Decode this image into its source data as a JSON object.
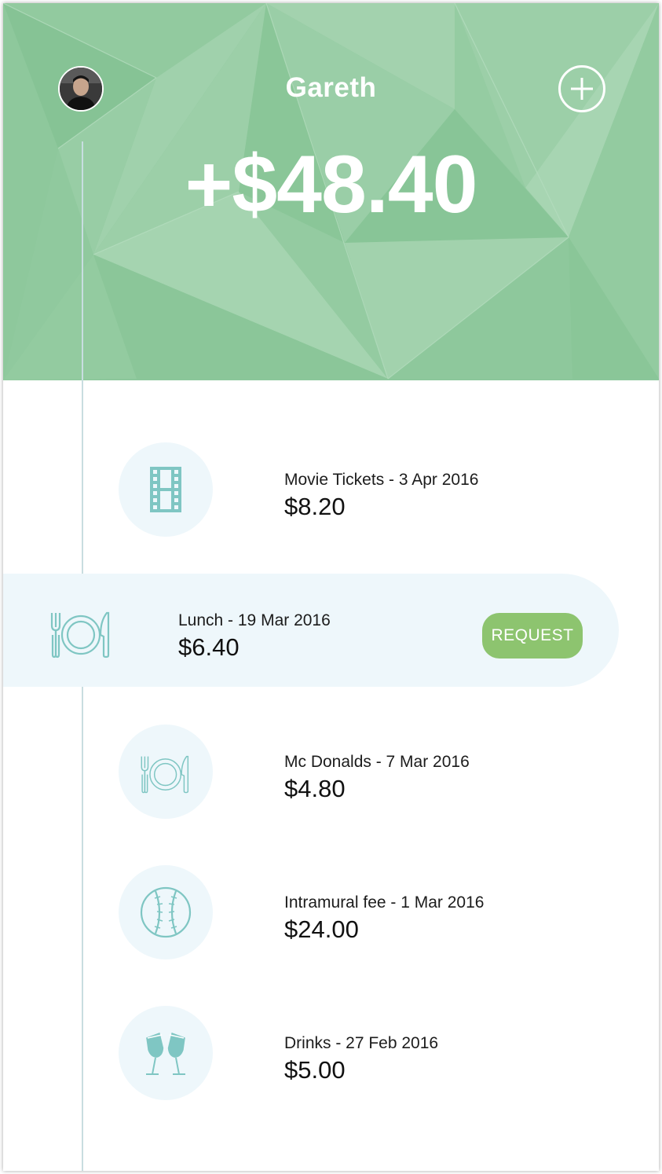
{
  "header": {
    "user_name": "Gareth",
    "balance": "+$48.40",
    "background_color": "#8cc79b",
    "add_icon": "plus-circle-icon",
    "avatar_icon": "avatar"
  },
  "transactions": [
    {
      "title": "Movie Tickets - 3 Apr 2016",
      "amount": "$8.20",
      "icon": "film-strip-icon"
    },
    {
      "title": "Lunch - 19 Mar 2016",
      "amount": "$6.40",
      "icon": "plate-cutlery-icon",
      "selected": true,
      "action_label": "REQUEST"
    },
    {
      "title": "Mc Donalds - 7 Mar 2016",
      "amount": "$4.80",
      "icon": "plate-cutlery-icon"
    },
    {
      "title": "Intramural fee - 1 Mar 2016",
      "amount": "$24.00",
      "icon": "baseball-icon"
    },
    {
      "title": "Drinks - 27 Feb 2016",
      "amount": "$5.00",
      "icon": "champagne-glasses-icon"
    }
  ],
  "colors": {
    "accent_green": "#8dc46f",
    "icon_teal": "#7fc6c3",
    "row_highlight": "#eef7fb"
  }
}
